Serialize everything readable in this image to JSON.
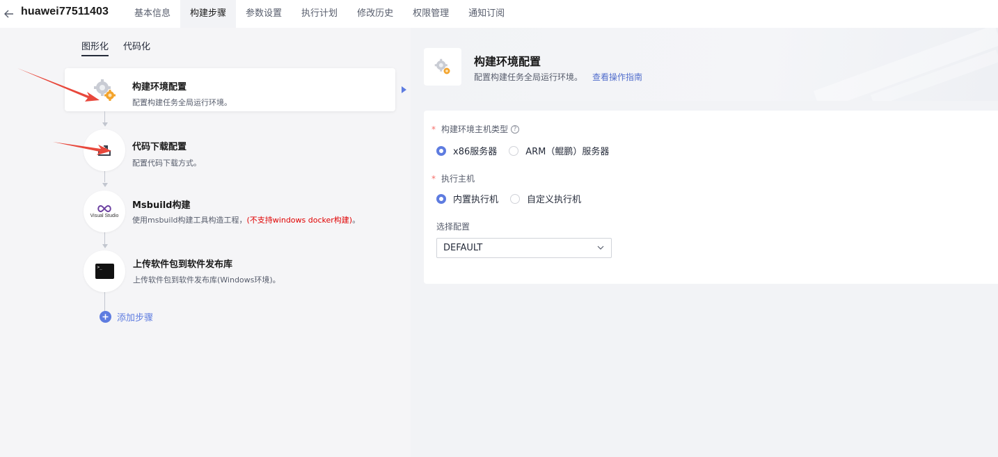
{
  "header": {
    "job_title": "huawei77511403",
    "tabs": [
      {
        "label": "基本信息"
      },
      {
        "label": "构建步骤",
        "active": true
      },
      {
        "label": "参数设置"
      },
      {
        "label": "执行计划"
      },
      {
        "label": "修改历史"
      },
      {
        "label": "权限管理"
      },
      {
        "label": "通知订阅"
      }
    ]
  },
  "left": {
    "mode_tabs": [
      {
        "label": "图形化",
        "active": true
      },
      {
        "label": "代码化"
      }
    ],
    "steps": [
      {
        "title": "构建环境配置",
        "desc": "配置构建任务全局运行环境。",
        "icon": "gear-cluster-icon"
      },
      {
        "title": "代码下载配置",
        "desc": "配置代码下载方式。",
        "icon": "download-tray-icon"
      },
      {
        "title": "Msbuild构建",
        "desc": "使用msbuild构建工具构造工程，",
        "desc_warn": "(不支持windows docker构建)",
        "desc_tail": "。",
        "icon": "visual-studio-icon",
        "icon_text": "Visual Studio"
      },
      {
        "title": "上传软件包到软件发布库",
        "desc": "上传软件包到软件发布库(Windows环境)。",
        "icon": "terminal-icon",
        "icon_text": ">_"
      }
    ],
    "add_step_label": "添加步骤"
  },
  "right": {
    "title": "构建环境配置",
    "desc": "配置构建任务全局运行环境。",
    "guide_link": "查看操作指南",
    "form": {
      "host_type": {
        "label": "构建环境主机类型",
        "required_mark": "*",
        "options": [
          {
            "label": "x86服务器",
            "checked": true
          },
          {
            "label": "ARM（鲲鹏）服务器",
            "checked": false
          }
        ]
      },
      "executor": {
        "label": "执行主机",
        "required_mark": "*",
        "options": [
          {
            "label": "内置执行机",
            "checked": true
          },
          {
            "label": "自定义执行机",
            "checked": false
          }
        ]
      },
      "config": {
        "label": "选择配置",
        "value": "DEFAULT"
      }
    }
  },
  "colors": {
    "accent": "#5e7ce0",
    "link": "#526ecc",
    "annotation": "#e8483c",
    "warn": "#e00000"
  }
}
